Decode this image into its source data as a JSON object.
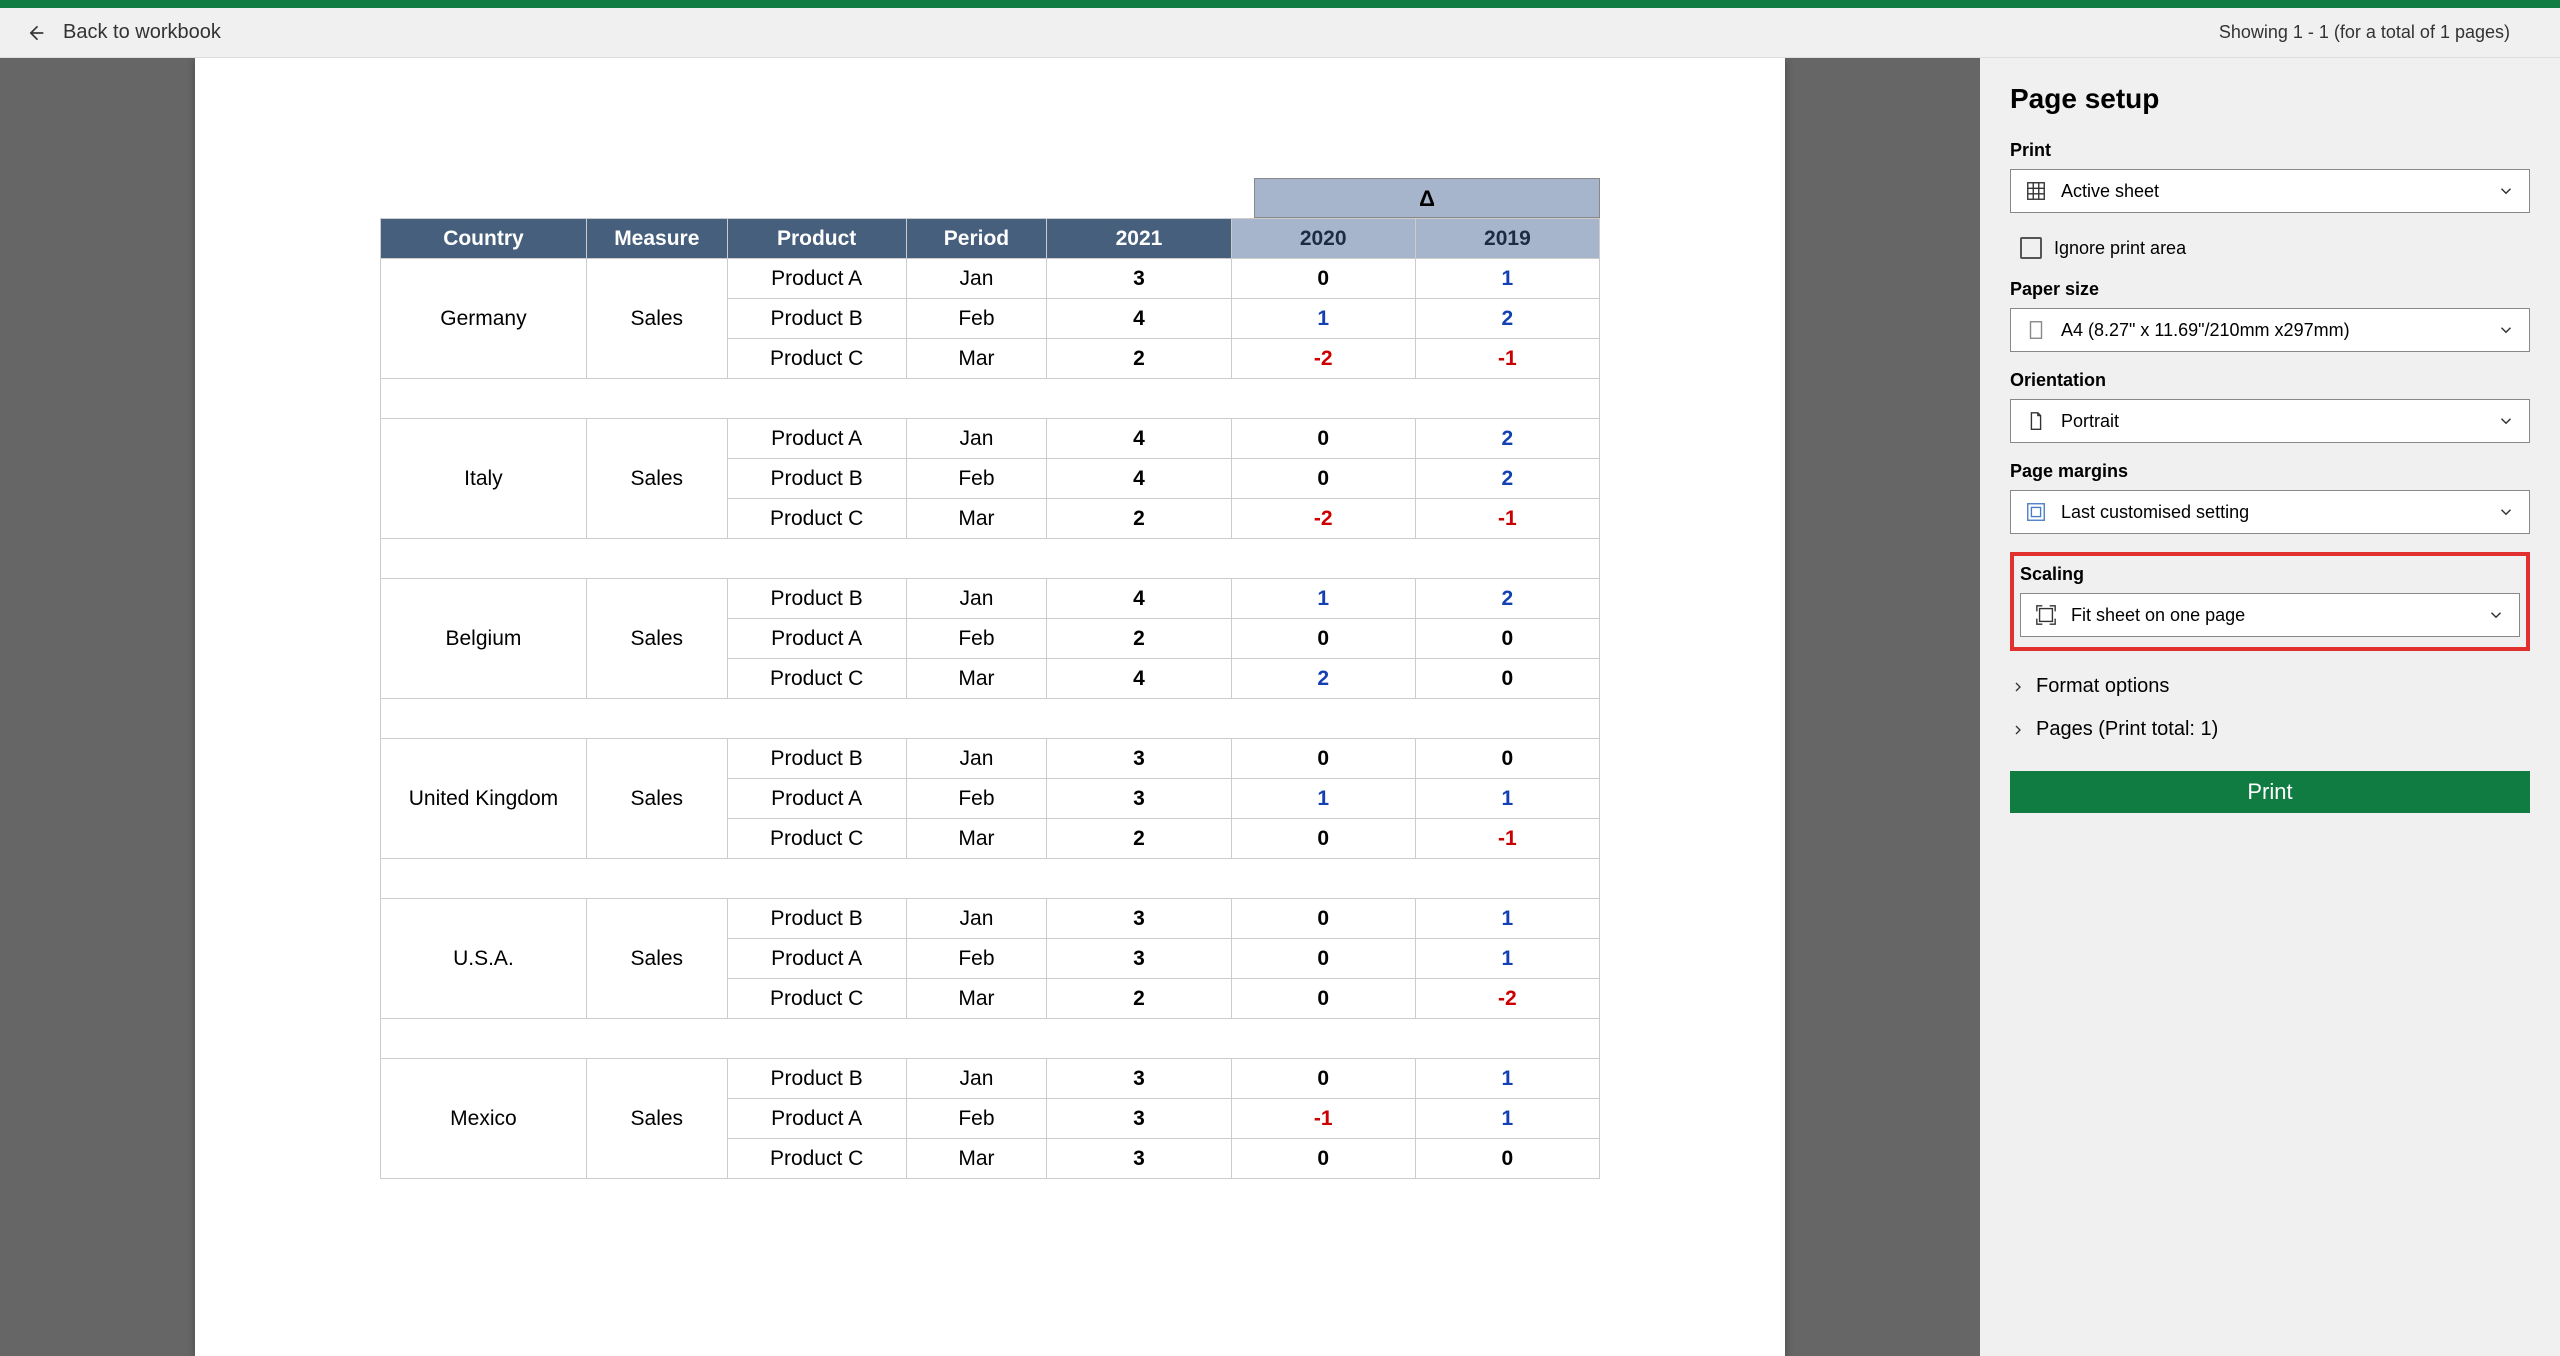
{
  "header": {
    "back_label": "Back to workbook",
    "page_info": "Showing 1 - 1 (for a total of 1 pages)"
  },
  "table": {
    "delta_symbol": "Δ",
    "headers": [
      "Country",
      "Measure",
      "Product",
      "Period",
      "2021",
      "2020",
      "2019"
    ],
    "groups": [
      {
        "country": "Germany",
        "measure": "Sales",
        "rows": [
          {
            "product": "Product A",
            "period": "Jan",
            "y2021": "3",
            "y2020": "0",
            "y2019": "1"
          },
          {
            "product": "Product B",
            "period": "Feb",
            "y2021": "4",
            "y2020": "1",
            "y2019": "2"
          },
          {
            "product": "Product C",
            "period": "Mar",
            "y2021": "2",
            "y2020": "-2",
            "y2019": "-1"
          }
        ]
      },
      {
        "country": "Italy",
        "measure": "Sales",
        "rows": [
          {
            "product": "Product A",
            "period": "Jan",
            "y2021": "4",
            "y2020": "0",
            "y2019": "2"
          },
          {
            "product": "Product B",
            "period": "Feb",
            "y2021": "4",
            "y2020": "0",
            "y2019": "2"
          },
          {
            "product": "Product C",
            "period": "Mar",
            "y2021": "2",
            "y2020": "-2",
            "y2019": "-1"
          }
        ]
      },
      {
        "country": "Belgium",
        "measure": "Sales",
        "rows": [
          {
            "product": "Product B",
            "period": "Jan",
            "y2021": "4",
            "y2020": "1",
            "y2019": "2"
          },
          {
            "product": "Product A",
            "period": "Feb",
            "y2021": "2",
            "y2020": "0",
            "y2019": "0"
          },
          {
            "product": "Product C",
            "period": "Mar",
            "y2021": "4",
            "y2020": "2",
            "y2019": "0"
          }
        ]
      },
      {
        "country": "United Kingdom",
        "measure": "Sales",
        "rows": [
          {
            "product": "Product B",
            "period": "Jan",
            "y2021": "3",
            "y2020": "0",
            "y2019": "0"
          },
          {
            "product": "Product A",
            "period": "Feb",
            "y2021": "3",
            "y2020": "1",
            "y2019": "1"
          },
          {
            "product": "Product C",
            "period": "Mar",
            "y2021": "2",
            "y2020": "0",
            "y2019": "-1"
          }
        ]
      },
      {
        "country": "U.S.A.",
        "measure": "Sales",
        "rows": [
          {
            "product": "Product B",
            "period": "Jan",
            "y2021": "3",
            "y2020": "0",
            "y2019": "1"
          },
          {
            "product": "Product A",
            "period": "Feb",
            "y2021": "3",
            "y2020": "0",
            "y2019": "1"
          },
          {
            "product": "Product C",
            "period": "Mar",
            "y2021": "2",
            "y2020": "0",
            "y2019": "-2"
          }
        ]
      },
      {
        "country": "Mexico",
        "measure": "Sales",
        "rows": [
          {
            "product": "Product B",
            "period": "Jan",
            "y2021": "3",
            "y2020": "0",
            "y2019": "1"
          },
          {
            "product": "Product A",
            "period": "Feb",
            "y2021": "3",
            "y2020": "-1",
            "y2019": "1"
          },
          {
            "product": "Product C",
            "period": "Mar",
            "y2021": "3",
            "y2020": "0",
            "y2019": "0"
          }
        ]
      }
    ]
  },
  "sidebar": {
    "title": "Page setup",
    "print_section_label": "Print",
    "print_value": "Active sheet",
    "ignore_print_area_label": "Ignore print area",
    "paper_size_label": "Paper size",
    "paper_size_value": "A4 (8.27\" x 11.69\"/210mm x297mm)",
    "orientation_label": "Orientation",
    "orientation_value": "Portrait",
    "margins_label": "Page margins",
    "margins_value": "Last customised setting",
    "scaling_label": "Scaling",
    "scaling_value": "Fit sheet on one page",
    "format_options_label": "Format options",
    "pages_label": "Pages (Print total: 1)",
    "print_button_label": "Print"
  }
}
